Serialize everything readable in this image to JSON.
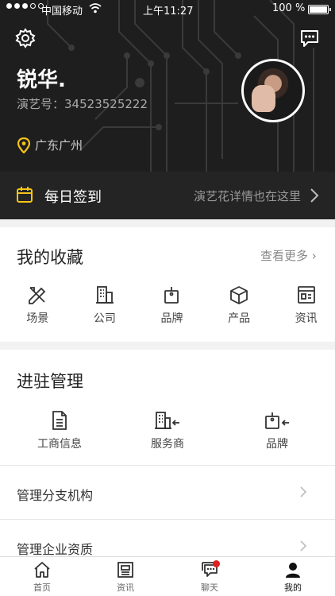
{
  "status_bar": {
    "carrier": "中国移动",
    "time": "上午11:27",
    "battery": "100 %"
  },
  "profile": {
    "name": "锐华.",
    "id_label": "演艺号：",
    "id_value": "34523525222",
    "location": "广东广州"
  },
  "checkin": {
    "label": "每日签到",
    "hint": "演艺花详情也在这里"
  },
  "favorites": {
    "title": "我的收藏",
    "more": "查看更多",
    "items": [
      {
        "label": "场景",
        "icon": "scene-icon"
      },
      {
        "label": "公司",
        "icon": "company-icon"
      },
      {
        "label": "品牌",
        "icon": "brand-icon"
      },
      {
        "label": "产品",
        "icon": "product-icon"
      },
      {
        "label": "资讯",
        "icon": "news-icon"
      }
    ]
  },
  "management": {
    "title": "进驻管理",
    "items": [
      {
        "label": "工商信息",
        "icon": "document-icon"
      },
      {
        "label": "服务商",
        "icon": "building-arrow-icon"
      },
      {
        "label": "品牌",
        "icon": "tag-arrow-icon"
      }
    ],
    "rows": [
      {
        "label": "管理分支机构"
      },
      {
        "label": "管理企业资质"
      }
    ]
  },
  "tabbar": {
    "items": [
      {
        "label": "首页",
        "icon": "home-icon"
      },
      {
        "label": "资讯",
        "icon": "news-icon"
      },
      {
        "label": "聊天",
        "icon": "chat-icon"
      },
      {
        "label": "我的",
        "icon": "person-icon"
      }
    ],
    "active": "我的"
  },
  "colors": {
    "accent": "#f5c518",
    "badge": "#e02020",
    "header_bg": "#1e1e1e"
  }
}
